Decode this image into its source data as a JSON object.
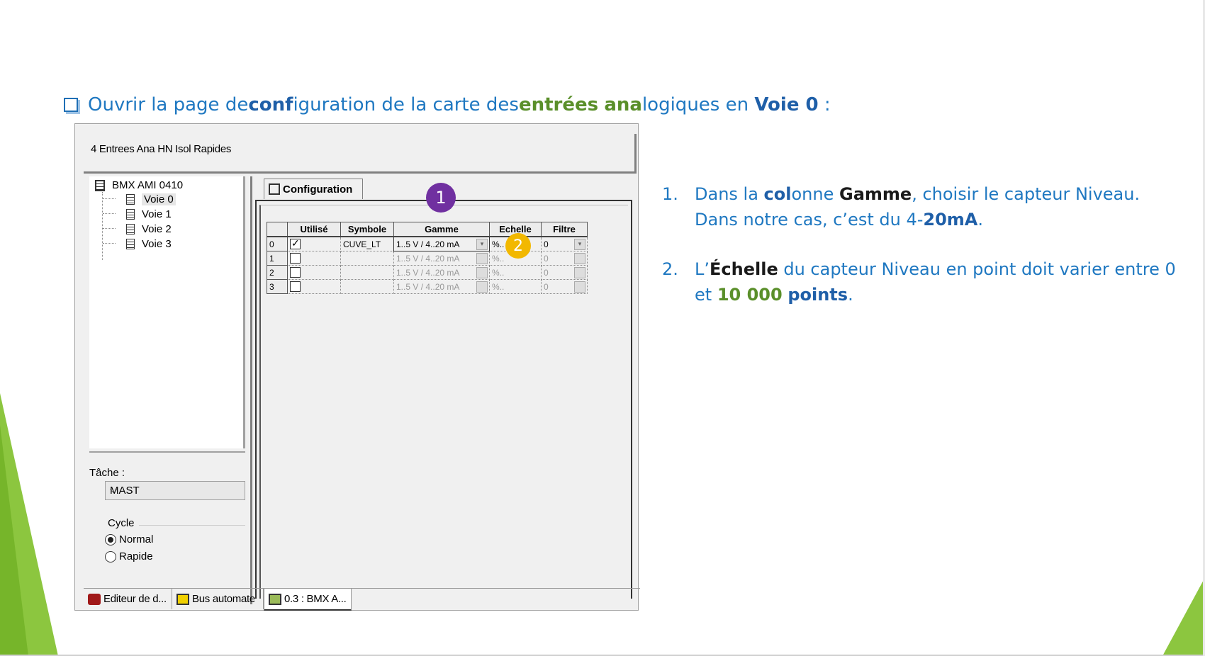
{
  "slide": {
    "title_parts": [
      "Ouvrir la page de ",
      "conf",
      "iguration de la carte des ",
      "entrées",
      " ",
      "ana",
      "logiques en ",
      "Voie 0",
      " :"
    ],
    "colors": {
      "accent_blue": "#1f78c1",
      "accent_green": "#5a8f2a",
      "badge1": "#7030a0",
      "badge2": "#f2b800",
      "deco_green": "#8cc63f"
    }
  },
  "window": {
    "title": "4 Entrees Ana HN Isol Rapides",
    "tree": {
      "root": "BMX AMI 0410",
      "items": [
        "Voie 0",
        "Voie 1",
        "Voie 2",
        "Voie 3"
      ],
      "selected": "Voie 0"
    },
    "task_label": "Tâche :",
    "task_value": "MAST",
    "cycle_label": "Cycle",
    "cycle_options": [
      "Normal",
      "Rapide"
    ],
    "cycle_selected": "Normal",
    "tab_label": "Configuration",
    "grid": {
      "headers": [
        "Utilisé",
        "Symbole",
        "Gamme",
        "Echelle",
        "Filtre"
      ],
      "rows": [
        {
          "num": "0",
          "used": true,
          "symbol": "CUVE_LT",
          "range": "1..5 V / 4..20 mA",
          "scale": "%..",
          "filter": "0"
        },
        {
          "num": "1",
          "used": false,
          "symbol": "",
          "range": "1..5 V / 4..20 mA",
          "scale": "%..",
          "filter": "0"
        },
        {
          "num": "2",
          "used": false,
          "symbol": "",
          "range": "1..5 V / 4..20 mA",
          "scale": "%..",
          "filter": "0"
        },
        {
          "num": "3",
          "used": false,
          "symbol": "",
          "range": "1..5 V / 4..20 mA",
          "scale": "%..",
          "filter": "0"
        }
      ]
    },
    "status_tabs": [
      "Editeur de d...",
      "Bus automate",
      "0.3 : BMX A..."
    ]
  },
  "badges": [
    "1",
    "2"
  ],
  "instructions": [
    {
      "num": "1.",
      "parts": [
        "Dans la ",
        "col",
        "onne ",
        "Gamme",
        ", choisir le capteur Niveau. Dans notre cas, c’est du 4-",
        "20mA",
        "."
      ]
    },
    {
      "num": "2.",
      "parts": [
        "L’",
        "Échelle",
        " du capteur Niveau en point doit varier entre 0 et ",
        "10 000",
        " ",
        "points",
        "."
      ]
    }
  ]
}
